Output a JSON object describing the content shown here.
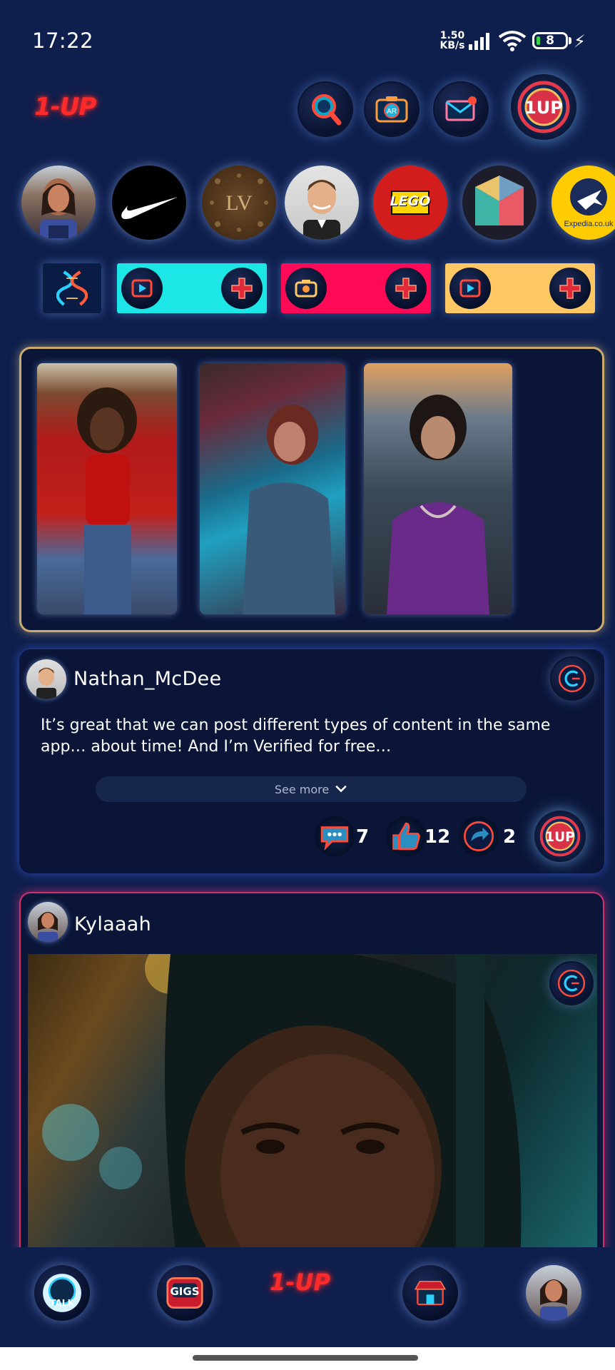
{
  "status_bar": {
    "time": "17:22",
    "net_speed_value": "1.50",
    "net_speed_unit": "KB/s",
    "battery_level": "8"
  },
  "header": {
    "logo": "1-UP",
    "icons": [
      "search-icon",
      "ar-camera-icon",
      "mail-icon",
      "1up-profile-icon"
    ]
  },
  "stories": [
    {
      "name": "user-story",
      "kind": "person"
    },
    {
      "name": "nike-story",
      "kind": "brand"
    },
    {
      "name": "louis-vuitton-story",
      "kind": "brand"
    },
    {
      "name": "user-story-man",
      "kind": "person"
    },
    {
      "name": "lego-story",
      "kind": "brand",
      "text": "LEGO"
    },
    {
      "name": "m-brand-story",
      "kind": "brand"
    },
    {
      "name": "expedia-story",
      "kind": "brand",
      "text": "Expedia.co.uk"
    }
  ],
  "media_row": {
    "pills": [
      {
        "icon": "video-icon",
        "color": "#1de6e6"
      },
      {
        "icon": "camera-icon",
        "color": "#ff0a56"
      },
      {
        "icon": "video-icon",
        "color": "#ffc864"
      }
    ]
  },
  "post1": {
    "username": "Nathan_McDee",
    "text": "It’s great that we can post different types of content in the same app… about time! And I’m Verified for free…",
    "see_more": "See more",
    "comments": "7",
    "likes": "12",
    "shares": "2"
  },
  "post2": {
    "username": "Kylaaah"
  },
  "bottom_nav": {
    "talk_label": "TALK",
    "gigs_label": "GIGS",
    "logo": "1-UP"
  },
  "colors": {
    "background": "#0f1f4d",
    "accent_red": "#ff2a2a",
    "reels_border": "#c9ab6e",
    "post2_border": "#d0306c"
  }
}
